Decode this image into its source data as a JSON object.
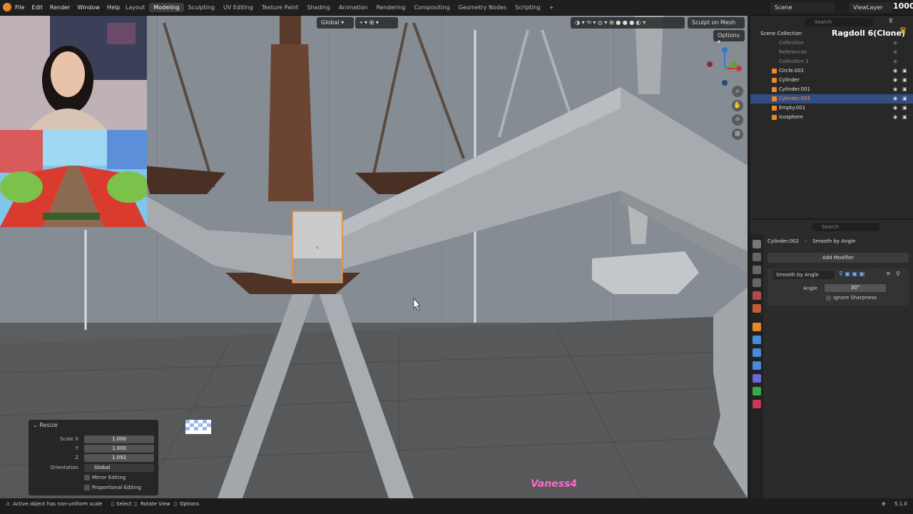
{
  "menu": {
    "items": [
      "File",
      "Edit",
      "Render",
      "Window",
      "Help"
    ]
  },
  "workspaces": {
    "tabs": [
      "Layout",
      "Modeling",
      "Sculpting",
      "UV Editing",
      "Texture Paint",
      "Shading",
      "Animation",
      "Rendering",
      "Compositing",
      "Geometry Nodes",
      "Scripting"
    ],
    "active": "Modeling"
  },
  "scene": {
    "scene_name": "Scene",
    "view_layer": "ViewLayer",
    "overlay_number": "1000"
  },
  "viewport": {
    "orientation": "Global",
    "sculpt_on_mesh": "Sculpt on Mesh",
    "options": "Options",
    "watermark": "Vaness4"
  },
  "outliner": {
    "search_placeholder": "Search",
    "title": "Scene Collection",
    "overlay_name": "Ragdoll 6(Clone)",
    "rows": [
      {
        "name": "Collection",
        "dim": true
      },
      {
        "name": "References",
        "dim": true
      },
      {
        "name": "Collection 3",
        "dim": true
      },
      {
        "name": "Circle.001",
        "dim": false
      },
      {
        "name": "Cylinder",
        "dim": false
      },
      {
        "name": "Cylinder.001",
        "dim": false
      },
      {
        "name": "Cylinder.002",
        "dim": false,
        "selected": true
      },
      {
        "name": "Empty.001",
        "dim": false
      },
      {
        "name": "Icosphere",
        "dim": false
      }
    ]
  },
  "properties": {
    "search_placeholder": "Search",
    "object": "Cylinder.002",
    "modifier_crumb": "Smooth by Angle",
    "add_modifier": "Add Modifier",
    "modifier_name": "Smooth by Angle",
    "angle_label": "Angle",
    "angle_value": "30°",
    "ignore_sharpness": "Ignore Sharpness"
  },
  "resize_panel": {
    "title": "Resize",
    "scale_x_label": "Scale X",
    "scale_x": "1.000",
    "y_label": "Y",
    "y": "1.000",
    "z_label": "Z",
    "z": "1.092",
    "orientation_label": "Orientation",
    "orientation": "Global",
    "mirror_editing": "Mirror Editing",
    "proportional_editing": "Proportional Editing"
  },
  "statusbar": {
    "message": "Active object has non-uniform scale",
    "select": "Select",
    "rotate_view": "Rotate View",
    "options": "Options",
    "version": "5.1.0"
  },
  "colors": {
    "accent": "#e88a2c",
    "selection": "#334d80",
    "watermark": "#ff66cc"
  }
}
